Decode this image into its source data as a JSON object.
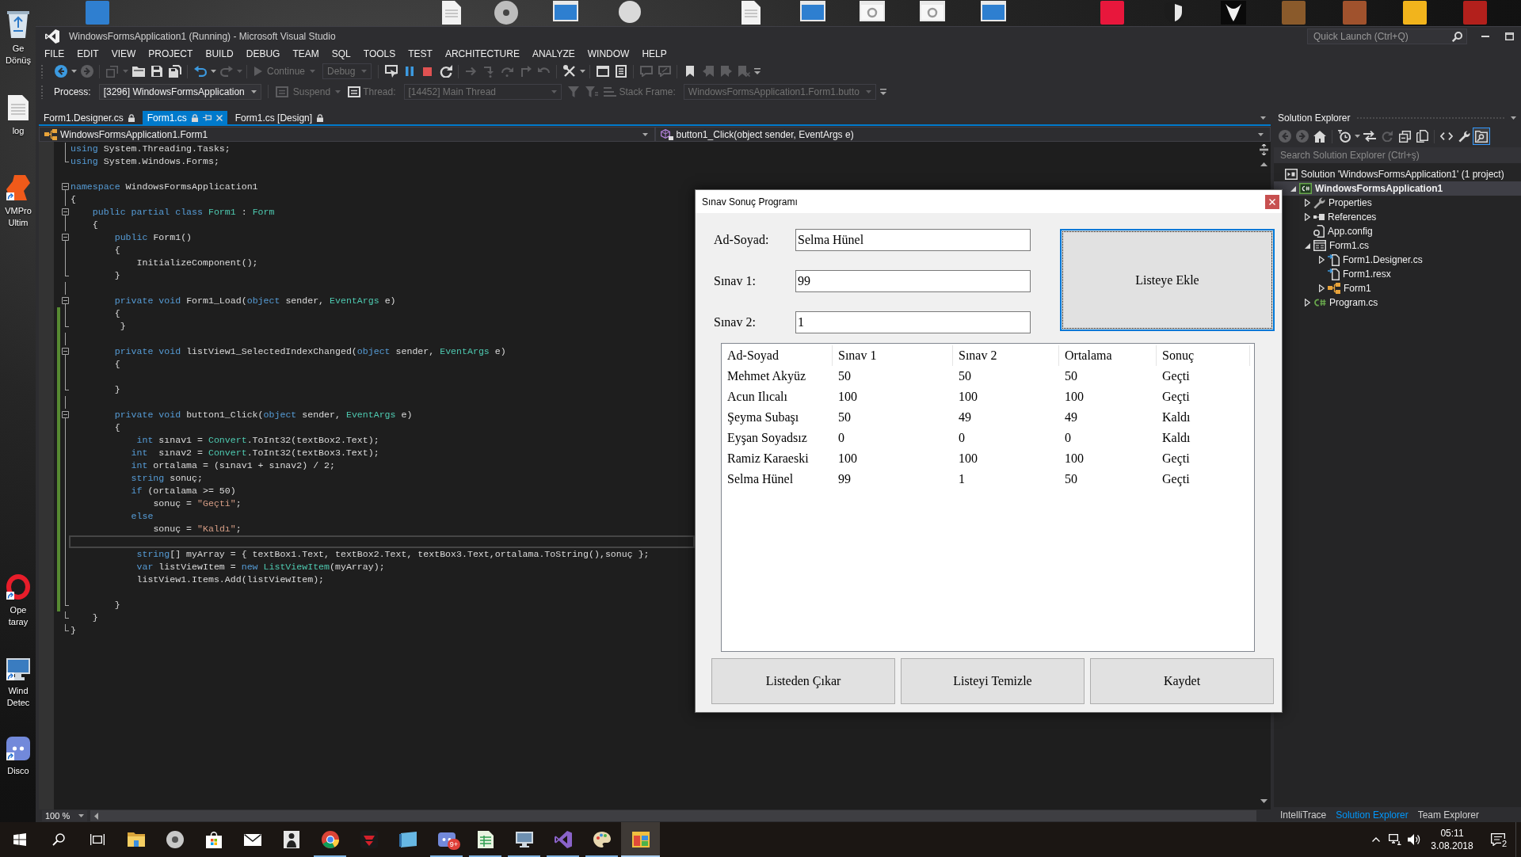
{
  "desktop": {
    "side_icons": [
      {
        "kind": "recycle-bin",
        "label": "Ge Dönüş",
        "shortcut": false
      },
      {
        "kind": "document",
        "label": "log",
        "shortcut": false
      },
      {
        "kind": "vmpro",
        "label": "VMPro Ultim",
        "shortcut": true
      },
      {
        "kind": "opera",
        "label": "Ope taray",
        "shortcut": true
      },
      {
        "kind": "monitor",
        "label": "Wind Detec",
        "shortcut": true
      },
      {
        "kind": "discord",
        "label": "Disco",
        "shortcut": true
      }
    ],
    "top_icons": [
      {
        "kind": "tile",
        "color": "#2f7fd0"
      },
      {
        "kind": "document"
      },
      {
        "kind": "disc"
      },
      {
        "kind": "window"
      },
      {
        "kind": "avatar"
      },
      {
        "kind": "document"
      },
      {
        "kind": "window"
      },
      {
        "kind": "window-gear"
      },
      {
        "kind": "window-gear"
      },
      {
        "kind": "window"
      },
      {
        "kind": "tile",
        "color": "#e8173c"
      },
      {
        "kind": "shield"
      },
      {
        "kind": "mask"
      },
      {
        "kind": "tile",
        "color": "#8a5a2b"
      },
      {
        "kind": "tile",
        "color": "#a0522d"
      },
      {
        "kind": "tile",
        "color": "#f2b41c"
      },
      {
        "kind": "tile",
        "color": "#b3201c"
      }
    ]
  },
  "window": {
    "title": "WindowsFormsApplication1 (Running) - Microsoft Visual Studio",
    "quick_launch": {
      "placeholder": "Quick Launch (Ctrl+Q)"
    }
  },
  "menu": [
    "FILE",
    "EDIT",
    "VIEW",
    "PROJECT",
    "BUILD",
    "DEBUG",
    "TEAM",
    "SQL",
    "TOOLS",
    "TEST",
    "ARCHITECTURE",
    "ANALYZE",
    "WINDOW",
    "HELP"
  ],
  "toolbar": [
    {
      "kind": "back",
      "disabled": false
    },
    {
      "kind": "caret",
      "disabled": false
    },
    {
      "kind": "forward",
      "disabled": true
    },
    {
      "kind": "separator"
    },
    {
      "kind": "new-project",
      "disabled": true
    },
    {
      "kind": "caret",
      "disabled": true
    },
    {
      "kind": "add-item",
      "disabled": false
    },
    {
      "kind": "save",
      "disabled": false
    },
    {
      "kind": "save-all",
      "disabled": false
    },
    {
      "kind": "separator"
    },
    {
      "kind": "undo",
      "disabled": false
    },
    {
      "kind": "caret",
      "disabled": false
    },
    {
      "kind": "redo",
      "disabled": true
    },
    {
      "kind": "caret",
      "disabled": true
    },
    {
      "kind": "separator"
    },
    {
      "kind": "continue",
      "text": "Continue",
      "disabled": true
    },
    {
      "kind": "combo",
      "text": "Debug",
      "disabled": true
    },
    {
      "kind": "separator"
    },
    {
      "kind": "attach",
      "disabled": false
    },
    {
      "kind": "pause",
      "disabled": false
    },
    {
      "kind": "stop",
      "disabled": false
    },
    {
      "kind": "restart",
      "disabled": false
    },
    {
      "kind": "separator"
    },
    {
      "kind": "show-next",
      "disabled": true
    },
    {
      "kind": "step-into",
      "disabled": true
    },
    {
      "kind": "step-over",
      "disabled": true
    },
    {
      "kind": "step-out",
      "disabled": true
    },
    {
      "kind": "step-back",
      "disabled": true
    },
    {
      "kind": "separator"
    },
    {
      "kind": "tools",
      "disabled": false
    },
    {
      "kind": "caret",
      "disabled": false
    },
    {
      "kind": "separator"
    },
    {
      "kind": "window",
      "disabled": false
    },
    {
      "kind": "list",
      "disabled": false
    },
    {
      "kind": "separator"
    },
    {
      "kind": "comment",
      "disabled": true
    },
    {
      "kind": "uncomment",
      "disabled": true
    },
    {
      "kind": "separator"
    },
    {
      "kind": "bookmark",
      "disabled": false
    },
    {
      "kind": "bookmark-prev",
      "disabled": true
    },
    {
      "kind": "bookmark-next",
      "disabled": true
    },
    {
      "kind": "bookmark-clear",
      "disabled": true
    },
    {
      "kind": "overflow",
      "disabled": false
    }
  ],
  "debug_location": [
    {
      "kind": "label",
      "text": "Process:",
      "disabled": false
    },
    {
      "kind": "combo",
      "text": "[3296] WindowsFormsApplication",
      "disabled": false
    },
    {
      "kind": "separator"
    },
    {
      "kind": "suspend",
      "text": "Suspend",
      "disabled": true
    },
    {
      "kind": "threads",
      "disabled": false
    },
    {
      "kind": "label",
      "text": "Thread:",
      "disabled": true
    },
    {
      "kind": "combo",
      "text": "[14452] Main Thread",
      "disabled": true
    },
    {
      "kind": "filter",
      "disabled": true
    },
    {
      "kind": "filter-flag",
      "disabled": true
    },
    {
      "kind": "stack",
      "disabled": true
    },
    {
      "kind": "label",
      "text": "Stack Frame:",
      "disabled": true
    },
    {
      "kind": "combo",
      "text": "WindowsFormsApplication1.Form1.butto",
      "disabled": true
    },
    {
      "kind": "overflow",
      "disabled": false
    }
  ],
  "document_tabs": [
    {
      "label": "Form1.Designer.cs",
      "selected": false,
      "locked": true
    },
    {
      "label": "Form1.cs",
      "selected": true,
      "locked": true
    },
    {
      "label": "Form1.cs [Design]",
      "selected": false,
      "locked": true
    }
  ],
  "navigation": [
    {
      "kind": "class",
      "text": "WindowsFormsApplication1.Form1"
    },
    {
      "kind": "method",
      "text": "button1_Click(object sender, EventArgs e)"
    }
  ],
  "editor": {
    "lines": [
      {
        "kind": "body",
        "tokens": [
          {
            "kind": "keyword",
            "text": "using"
          },
          {
            "kind": "plain",
            "text": " System.Threading.Tasks;"
          }
        ],
        "changed": false,
        "current": false
      },
      {
        "kind": "end",
        "tokens": [
          {
            "kind": "keyword",
            "text": "using"
          },
          {
            "kind": "plain",
            "text": " System.Windows.Forms;"
          }
        ],
        "changed": false,
        "current": false
      },
      {
        "kind": "plain",
        "changed": false,
        "current": false
      },
      {
        "kind": "start",
        "tokens": [
          {
            "kind": "keyword",
            "text": "namespace"
          },
          {
            "kind": "plain",
            "text": " WindowsFormsApplication1"
          }
        ],
        "changed": false,
        "current": false
      },
      {
        "kind": "body",
        "tokens": [
          {
            "kind": "plain",
            "text": "{"
          }
        ],
        "changed": false,
        "current": false
      },
      {
        "kind": "start",
        "tokens": [
          {
            "kind": "keyword",
            "text": "    public partial class"
          },
          {
            "kind": "type",
            "text": " Form1"
          },
          {
            "kind": "plain",
            "text": " : "
          },
          {
            "kind": "type",
            "text": "Form"
          }
        ],
        "changed": false,
        "current": false
      },
      {
        "kind": "body",
        "tokens": [
          {
            "kind": "plain",
            "text": "    {"
          }
        ],
        "changed": false,
        "current": false
      },
      {
        "kind": "start",
        "tokens": [
          {
            "kind": "keyword",
            "text": "        public"
          },
          {
            "kind": "plain",
            "text": " Form1()"
          }
        ],
        "changed": false,
        "current": false
      },
      {
        "kind": "body",
        "tokens": [
          {
            "kind": "plain",
            "text": "        {"
          }
        ],
        "changed": false,
        "current": false
      },
      {
        "kind": "body",
        "tokens": [
          {
            "kind": "plain",
            "text": "            InitializeComponent();"
          }
        ],
        "changed": false,
        "current": false
      },
      {
        "kind": "end",
        "tokens": [
          {
            "kind": "plain",
            "text": "        }"
          }
        ],
        "changed": false,
        "current": false
      },
      {
        "kind": "body",
        "changed": false,
        "current": false
      },
      {
        "kind": "start",
        "tokens": [
          {
            "kind": "keyword",
            "text": "        private void"
          },
          {
            "kind": "plain",
            "text": " Form1_Load("
          },
          {
            "kind": "keyword",
            "text": "object"
          },
          {
            "kind": "plain",
            "text": " sender, "
          },
          {
            "kind": "type",
            "text": "EventArgs"
          },
          {
            "kind": "plain",
            "text": " e)"
          }
        ],
        "changed": false,
        "current": false
      },
      {
        "kind": "body",
        "tokens": [
          {
            "kind": "plain",
            "text": "        {"
          }
        ],
        "changed": true,
        "current": false
      },
      {
        "kind": "end",
        "tokens": [
          {
            "kind": "plain",
            "text": "         }"
          }
        ],
        "changed": true,
        "current": false
      },
      {
        "kind": "body",
        "changed": true,
        "current": false
      },
      {
        "kind": "start",
        "tokens": [
          {
            "kind": "keyword",
            "text": "        private void"
          },
          {
            "kind": "plain",
            "text": " listView1_SelectedIndexChanged("
          },
          {
            "kind": "keyword",
            "text": "object"
          },
          {
            "kind": "plain",
            "text": " sender, "
          },
          {
            "kind": "type",
            "text": "EventArgs"
          },
          {
            "kind": "plain",
            "text": " e)"
          }
        ],
        "changed": true,
        "current": false
      },
      {
        "kind": "body",
        "tokens": [
          {
            "kind": "plain",
            "text": "        {"
          }
        ],
        "changed": true,
        "current": false
      },
      {
        "kind": "body",
        "changed": true,
        "current": false
      },
      {
        "kind": "end",
        "tokens": [
          {
            "kind": "plain",
            "text": "        }"
          }
        ],
        "changed": true,
        "current": false
      },
      {
        "kind": "body",
        "changed": true,
        "current": false
      },
      {
        "kind": "start",
        "tokens": [
          {
            "kind": "keyword",
            "text": "        private void"
          },
          {
            "kind": "plain",
            "text": " button1_Click("
          },
          {
            "kind": "keyword",
            "text": "object"
          },
          {
            "kind": "plain",
            "text": " sender, "
          },
          {
            "kind": "type",
            "text": "EventArgs"
          },
          {
            "kind": "plain",
            "text": " e)"
          }
        ],
        "changed": true,
        "current": false
      },
      {
        "kind": "body",
        "tokens": [
          {
            "kind": "plain",
            "text": "        {"
          }
        ],
        "changed": true,
        "current": false
      },
      {
        "kind": "body",
        "tokens": [
          {
            "kind": "keyword",
            "text": "            int"
          },
          {
            "kind": "plain",
            "text": " sınav1 = "
          },
          {
            "kind": "type",
            "text": "Convert"
          },
          {
            "kind": "plain",
            "text": ".ToInt32(textBox2.Text);"
          }
        ],
        "changed": true,
        "current": false
      },
      {
        "kind": "body",
        "tokens": [
          {
            "kind": "keyword",
            "text": "           int"
          },
          {
            "kind": "plain",
            "text": "  sınav2 = "
          },
          {
            "kind": "type",
            "text": "Convert"
          },
          {
            "kind": "plain",
            "text": ".ToInt32(textBox3.Text);"
          }
        ],
        "changed": true,
        "current": false
      },
      {
        "kind": "body",
        "tokens": [
          {
            "kind": "keyword",
            "text": "           int"
          },
          {
            "kind": "plain",
            "text": " ortalama = (sınav1 + sınav2) / 2;"
          }
        ],
        "changed": true,
        "current": false
      },
      {
        "kind": "body",
        "tokens": [
          {
            "kind": "keyword",
            "text": "           string"
          },
          {
            "kind": "plain",
            "text": " sonuç;"
          }
        ],
        "changed": true,
        "current": false
      },
      {
        "kind": "body",
        "tokens": [
          {
            "kind": "keyword",
            "text": "           if"
          },
          {
            "kind": "plain",
            "text": " (ortalama >= 50)"
          }
        ],
        "changed": true,
        "current": false
      },
      {
        "kind": "body",
        "tokens": [
          {
            "kind": "plain",
            "text": "               sonuç = "
          },
          {
            "kind": "string",
            "text": "\"Geçti\""
          },
          {
            "kind": "plain",
            "text": ";"
          }
        ],
        "changed": true,
        "current": false
      },
      {
        "kind": "body",
        "tokens": [
          {
            "kind": "keyword",
            "text": "           else"
          }
        ],
        "changed": true,
        "current": false
      },
      {
        "kind": "body",
        "tokens": [
          {
            "kind": "plain",
            "text": "               sonuç = "
          },
          {
            "kind": "string",
            "text": "\"Kaldı\""
          },
          {
            "kind": "plain",
            "text": ";"
          }
        ],
        "changed": true,
        "current": false
      },
      {
        "kind": "body",
        "changed": true,
        "current": true
      },
      {
        "kind": "body",
        "tokens": [
          {
            "kind": "keyword",
            "text": "            string"
          },
          {
            "kind": "plain",
            "text": "[] myArray = { textBox1.Text, textBox2.Text, textBox3.Text,ortalama.ToString(),sonuç };"
          }
        ],
        "changed": true,
        "current": false
      },
      {
        "kind": "body",
        "tokens": [
          {
            "kind": "keyword",
            "text": "            var"
          },
          {
            "kind": "plain",
            "text": " listViewItem = "
          },
          {
            "kind": "keyword",
            "text": "new"
          },
          {
            "kind": "type",
            "text": " ListViewItem"
          },
          {
            "kind": "plain",
            "text": "(myArray);"
          }
        ],
        "changed": true,
        "current": false
      },
      {
        "kind": "body",
        "tokens": [
          {
            "kind": "plain",
            "text": "            listView1.Items.Add(listViewItem);"
          }
        ],
        "changed": true,
        "current": false
      },
      {
        "kind": "body",
        "changed": true,
        "current": false
      },
      {
        "kind": "end",
        "tokens": [
          {
            "kind": "plain",
            "text": "        }"
          }
        ],
        "changed": true,
        "current": false
      },
      {
        "kind": "end",
        "tokens": [
          {
            "kind": "plain",
            "text": "    }"
          }
        ],
        "changed": false,
        "current": false
      },
      {
        "kind": "end",
        "tokens": [
          {
            "kind": "plain",
            "text": "}"
          }
        ],
        "changed": false,
        "current": false
      }
    ],
    "zoom": "100 %"
  },
  "solution_explorer": {
    "title": "Solution Explorer",
    "toolbar": [
      {
        "kind": "back",
        "disabled": true,
        "on": false
      },
      {
        "kind": "forward",
        "disabled": true,
        "on": false
      },
      {
        "kind": "home",
        "disabled": false,
        "on": false
      },
      {
        "kind": "separator"
      },
      {
        "kind": "history",
        "disabled": false,
        "on": false
      },
      {
        "kind": "caret",
        "disabled": false
      },
      {
        "kind": "sync",
        "disabled": false,
        "on": false
      },
      {
        "kind": "refresh",
        "disabled": true,
        "on": false
      },
      {
        "kind": "collapse",
        "disabled": false,
        "on": false
      },
      {
        "kind": "show-all",
        "disabled": false,
        "on": false
      },
      {
        "kind": "separator"
      },
      {
        "kind": "code",
        "disabled": false,
        "on": false
      },
      {
        "kind": "wrench",
        "disabled": false,
        "on": false
      },
      {
        "kind": "preview",
        "disabled": false,
        "on": true
      }
    ],
    "search": {
      "placeholder": "Search Solution Explorer (Ctrl+ş)"
    },
    "tree": [
      {
        "label": "Solution 'WindowsFormsApplication1' (1 project)",
        "kind": "solution",
        "selected": false,
        "children": [
          {
            "label": "WindowsFormsApplication1",
            "kind": "project",
            "expanded": true,
            "selected": true,
            "children": [
              {
                "label": "Properties",
                "kind": "properties",
                "expanded": false,
                "selected": false
              },
              {
                "label": "References",
                "kind": "references",
                "expanded": false,
                "selected": false
              },
              {
                "label": "App.config",
                "kind": "config",
                "selected": false
              },
              {
                "label": "Form1.cs",
                "kind": "form",
                "expanded": true,
                "selected": false,
                "children": [
                  {
                    "label": "Form1.Designer.cs",
                    "kind": "designer",
                    "expanded": false,
                    "selected": false
                  },
                  {
                    "label": "Form1.resx",
                    "kind": "resx",
                    "selected": false
                  },
                  {
                    "label": "Form1",
                    "kind": "class",
                    "expanded": false,
                    "selected": false
                  }
                ]
              },
              {
                "label": "Program.cs",
                "kind": "csfile",
                "expanded": false,
                "selected": false
              }
            ]
          }
        ]
      }
    ],
    "tabs": [
      {
        "label": "IntelliTrace",
        "selected": false
      },
      {
        "label": "Solution Explorer",
        "selected": true
      },
      {
        "label": "Team Explorer",
        "selected": false
      }
    ]
  },
  "dialog": {
    "title": "Sınav Sonuç Programı",
    "fields": [
      {
        "label": "Ad-Soyad:",
        "value": "Selma Hünel"
      },
      {
        "label": "Sınav 1:",
        "value": "99"
      },
      {
        "label": "Sınav 2:",
        "value": "1"
      }
    ],
    "add_button": {
      "label": "Listeye Ekle",
      "focused": true
    },
    "list": {
      "columns": [
        "Ad-Soyad",
        "Sınav 1",
        "Sınav 2",
        "Ortalama",
        "Sonuç"
      ],
      "rows": [
        {
          "cells": [
            "Mehmet Akyüz",
            "50",
            "50",
            "50",
            "Geçti"
          ],
          "selected": false
        },
        {
          "cells": [
            "Acun Ilıcalı",
            "100",
            "100",
            "100",
            "Geçti"
          ],
          "selected": false
        },
        {
          "cells": [
            "Şeyma Subaşı",
            "50",
            "49",
            "49",
            "Kaldı"
          ],
          "selected": false
        },
        {
          "cells": [
            "Eyşan Soyadsız",
            "0",
            "0",
            "0",
            "Kaldı"
          ],
          "selected": false
        },
        {
          "cells": [
            "Ramiz Karaeski",
            "100",
            "100",
            "100",
            "Geçti"
          ],
          "selected": false
        },
        {
          "cells": [
            "Selma Hünel",
            "99",
            "1",
            "50",
            "Geçti"
          ],
          "selected": false
        }
      ]
    },
    "buttons": [
      {
        "label": "Listeden Çıkar",
        "focused": false
      },
      {
        "label": "Listeyi Temizle",
        "focused": false
      },
      {
        "label": "Kaydet",
        "focused": false
      }
    ]
  },
  "taskbar": {
    "apps": [
      {
        "kind": "start",
        "running": false,
        "selected": false
      },
      {
        "kind": "search",
        "running": false,
        "selected": false
      },
      {
        "kind": "task-view",
        "running": false,
        "selected": false
      },
      {
        "kind": "folder",
        "running": false,
        "selected": false
      },
      {
        "kind": "disc",
        "running": false,
        "selected": false
      },
      {
        "kind": "store",
        "running": false,
        "selected": false
      },
      {
        "kind": "mail",
        "running": false,
        "selected": false
      },
      {
        "kind": "figure",
        "running": false,
        "selected": false
      },
      {
        "kind": "chrome",
        "running": true,
        "selected": false
      },
      {
        "kind": "red-app",
        "running": false,
        "selected": false
      },
      {
        "kind": "notebook",
        "running": false,
        "selected": false
      },
      {
        "kind": "discord",
        "running": true,
        "selected": false,
        "badge": "9+"
      },
      {
        "kind": "sheet",
        "running": true,
        "selected": false
      },
      {
        "kind": "remote",
        "running": true,
        "selected": false
      },
      {
        "kind": "vs",
        "running": true,
        "selected": false
      },
      {
        "kind": "paint",
        "running": true,
        "selected": false
      },
      {
        "kind": "colorful",
        "running": true,
        "selected": true
      }
    ],
    "tray": [
      {
        "kind": "chevron"
      },
      {
        "kind": "network"
      },
      {
        "kind": "volume"
      }
    ],
    "time": "05:11",
    "date": "3.08.2018",
    "notification_count": "2"
  }
}
